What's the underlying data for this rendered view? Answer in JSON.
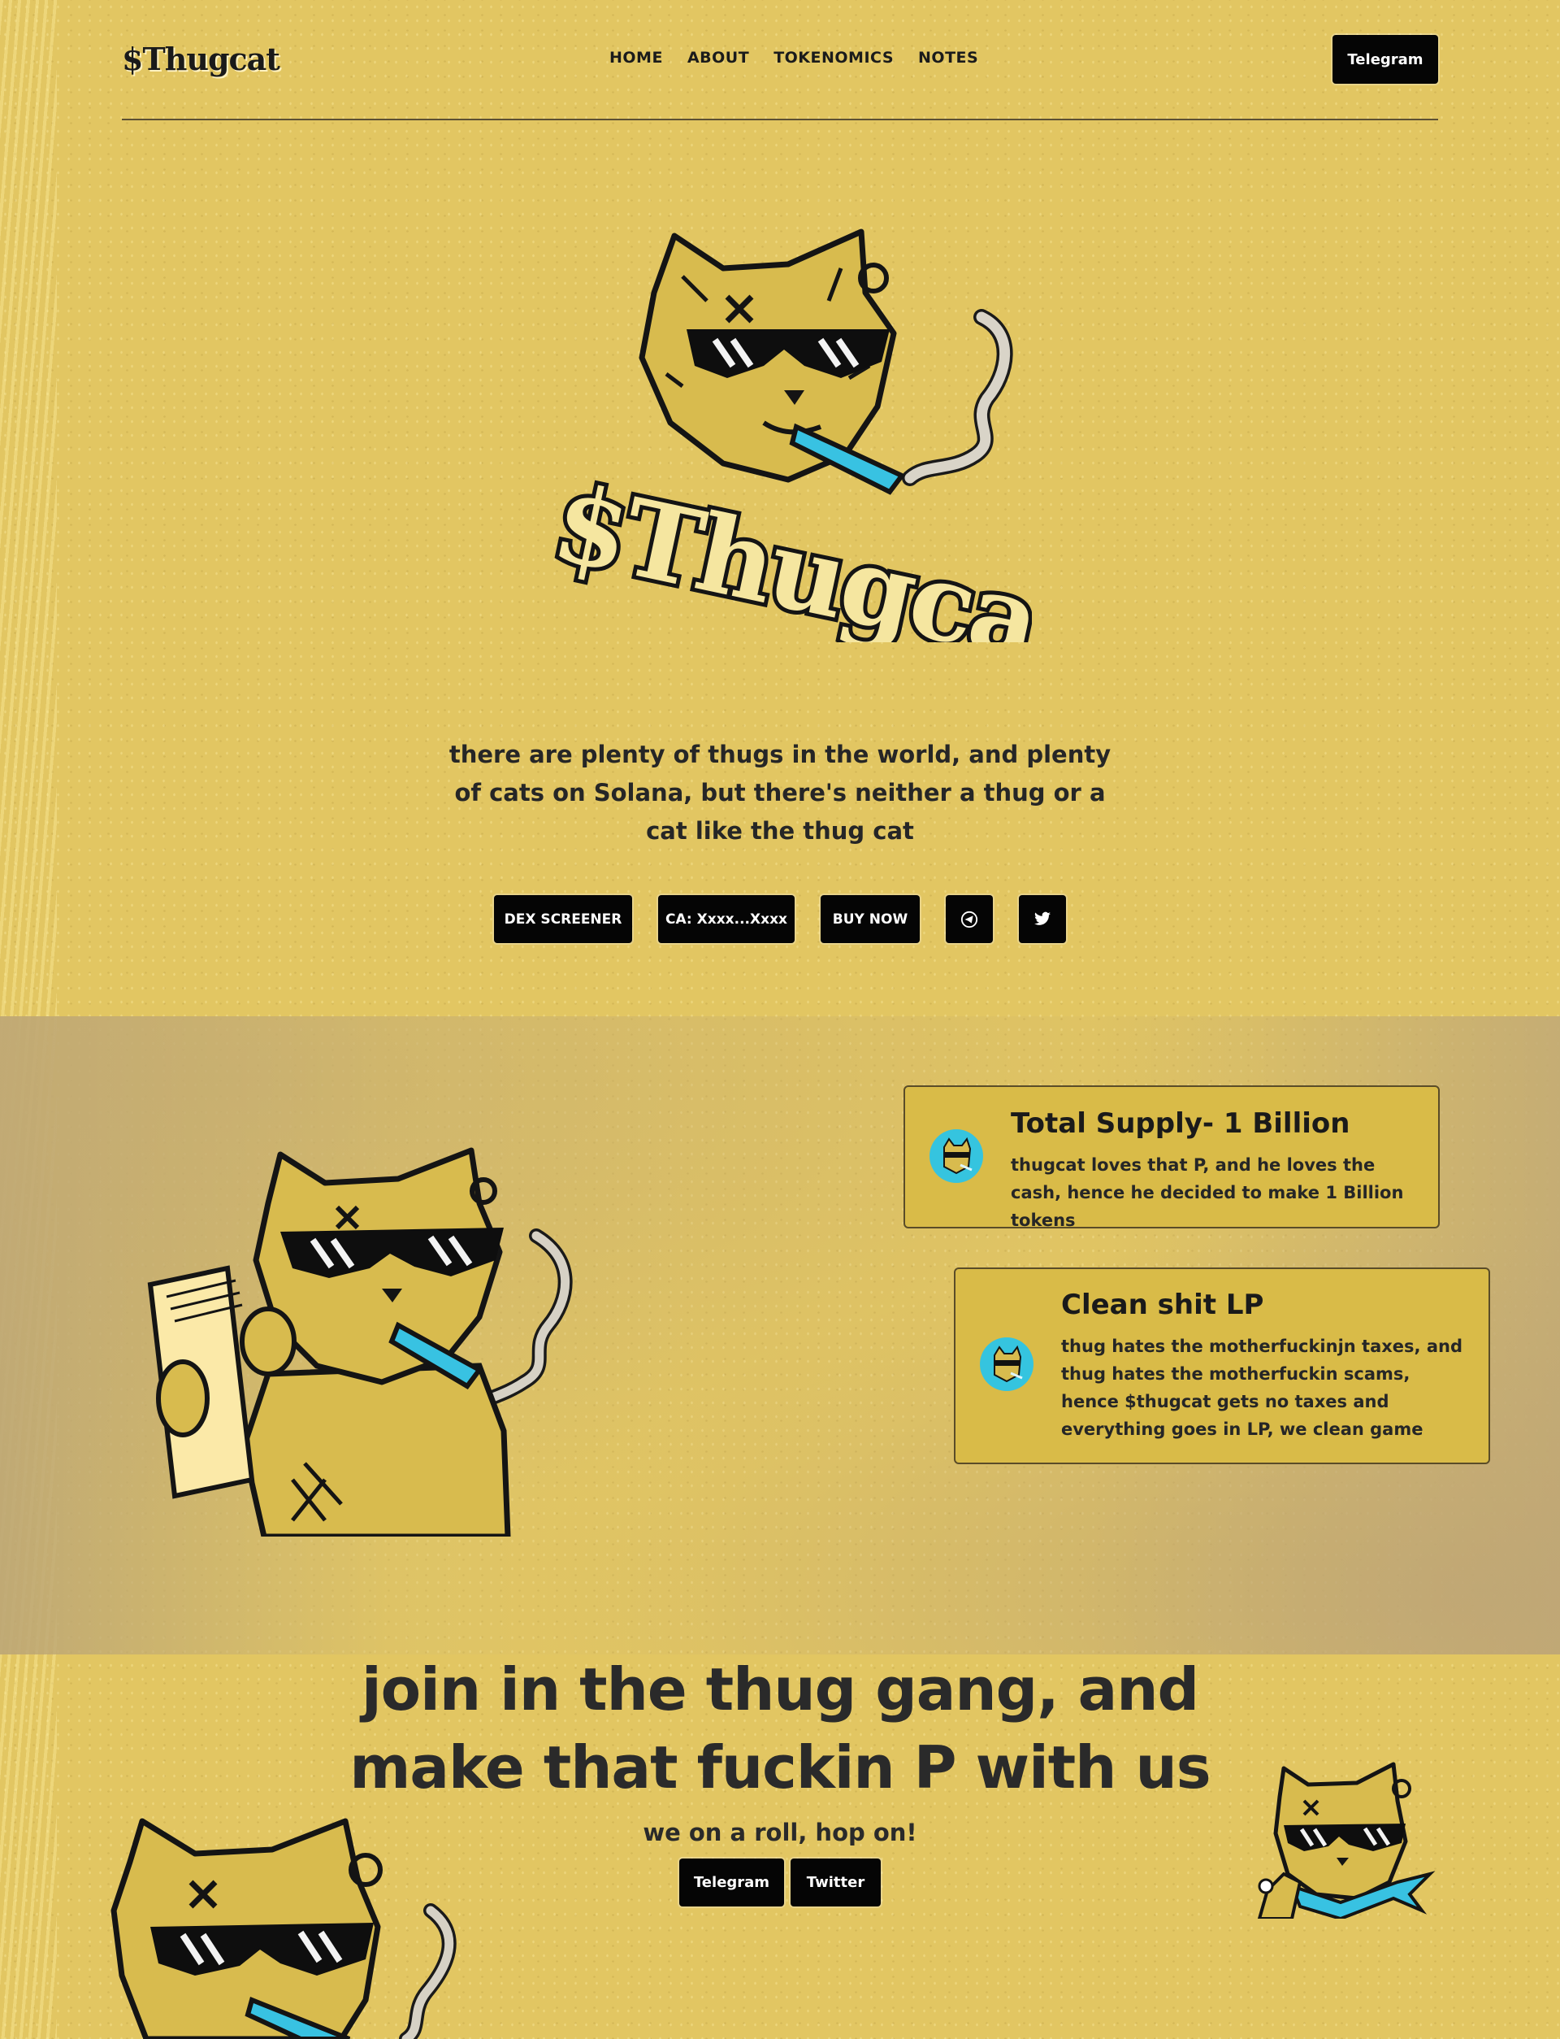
{
  "header": {
    "logo": "$Thugcat",
    "nav": [
      "HOME",
      "ABOUT",
      "TOKENOMICS",
      "NOTES"
    ],
    "telegram_label": "Telegram"
  },
  "hero": {
    "brand_art_text": "$Thugcat",
    "description": "there are plenty of thugs in the world, and plenty of cats on Solana, but there's neither a thug or a cat like the thug cat",
    "buttons": {
      "dex": "DEX SCREENER",
      "ca": "CA: Xxxx...Xxxx",
      "buy": "BUY NOW"
    },
    "icons": [
      "telegram-icon",
      "twitter-icon"
    ]
  },
  "tokenomics": {
    "cards": [
      {
        "title": "Total Supply- 1 Billion",
        "text": "thugcat loves that P, and he loves the cash, hence he decided to make 1 Billion tokens"
      },
      {
        "title": "Clean shit LP",
        "text": "thug hates the motherfuckinjn taxes, and thug hates the motherfuckin scams, hence $thugcat gets no taxes and everything goes in LP, we clean game"
      }
    ],
    "money_symbol": "$"
  },
  "join": {
    "title": "join in the thug gang, and make that fuckin P with us",
    "subtitle": "we on a roll, hop on!",
    "telegram_label": "Telegram",
    "twitter_label": "Twitter"
  },
  "colors": {
    "background": "#e2c662",
    "card": "#d9bb48",
    "button": "#050505",
    "accent_blue": "#35c4df",
    "outline": "#1a1a1a"
  }
}
